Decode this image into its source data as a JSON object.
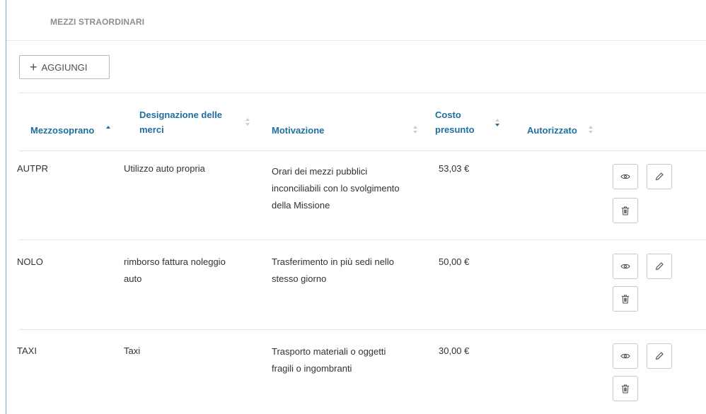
{
  "section": {
    "title": "MEZZI STRAORDINARI"
  },
  "toolbar": {
    "add_icon": "plus-icon",
    "add_label": "AGGIUNGI"
  },
  "table": {
    "columns": [
      {
        "line1": "Mezzosoprano",
        "line2": "",
        "sort": "asc"
      },
      {
        "line1": "Designazione delle",
        "line2": "merci",
        "sort": "none"
      },
      {
        "line1": "Motivazione",
        "line2": "",
        "sort": "none"
      },
      {
        "line1": "Costo",
        "line2": "presunto",
        "sort": "desc"
      },
      {
        "line1": "Autorizzato",
        "line2": "",
        "sort": "none"
      }
    ],
    "rows": [
      {
        "mezzo": "AUTPR",
        "designazione": [
          "Utilizzo auto propria"
        ],
        "motivazione": [
          "Orari dei mezzi pubblici",
          "inconciliabili con lo svolgimento",
          "della Missione"
        ],
        "costo": "53,03 €",
        "autorizzato": ""
      },
      {
        "mezzo": "NOLO",
        "designazione": [
          "rimborso fattura noleggio",
          "auto"
        ],
        "motivazione": [
          "Trasferimento in più sedi nello",
          "stesso giorno"
        ],
        "costo": "50,00 €",
        "autorizzato": ""
      },
      {
        "mezzo": "TAXI",
        "designazione": [
          "Taxi"
        ],
        "motivazione": [
          "Trasporto materiali o oggetti",
          "fragili o ingombranti"
        ],
        "costo": "30,00 €",
        "autorizzato": ""
      }
    ],
    "row_actions": [
      "eye-icon",
      "pencil-icon",
      "trash-icon"
    ]
  },
  "colors": {
    "header_text": "#1f6f9e",
    "border_left": "#7fa7c4",
    "section_title": "#8a8f95"
  }
}
